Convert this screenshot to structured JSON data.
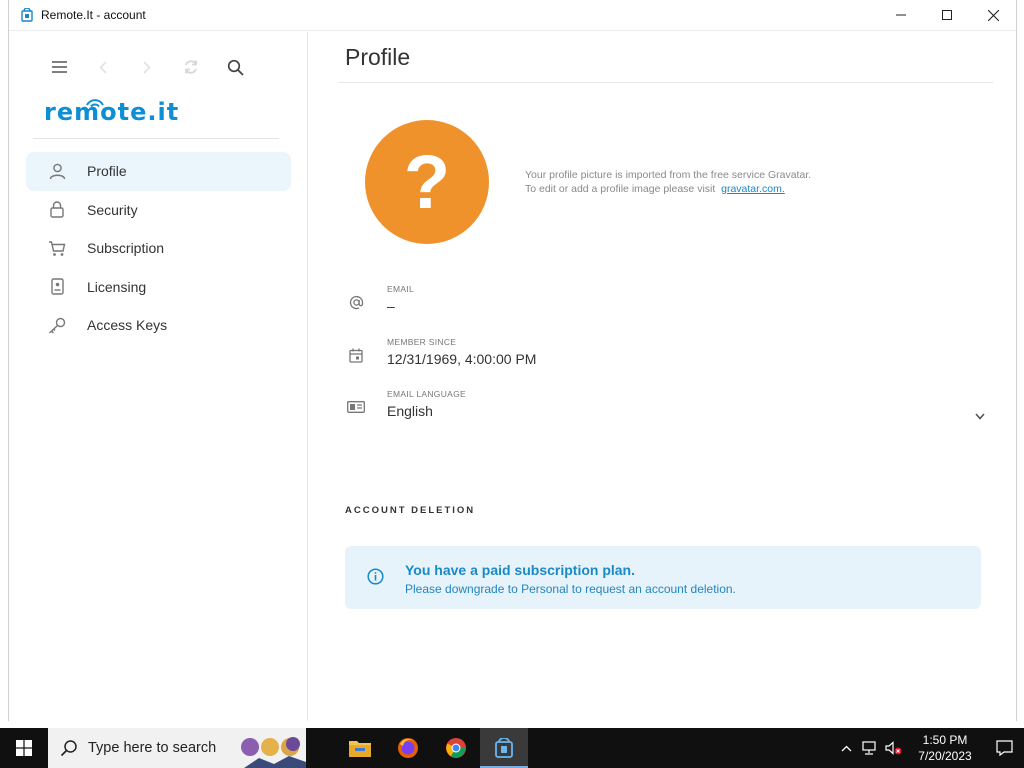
{
  "window": {
    "title": "Remote.It - account",
    "minimize_icon": "minimize-icon",
    "maximize_icon": "maximize-icon",
    "close_icon": "close-icon"
  },
  "sidebar": {
    "logo_text": "remote.it",
    "toolbar": [
      "menu-icon",
      "back-icon",
      "forward-icon",
      "refresh-icon",
      "search-icon"
    ],
    "items": [
      {
        "label": "Profile",
        "icon": "person-icon",
        "active": true
      },
      {
        "label": "Security",
        "icon": "lock-icon",
        "active": false
      },
      {
        "label": "Subscription",
        "icon": "cart-icon",
        "active": false
      },
      {
        "label": "Licensing",
        "icon": "badge-icon",
        "active": false
      },
      {
        "label": "Access Keys",
        "icon": "key-icon",
        "active": false
      }
    ]
  },
  "main": {
    "title": "Profile",
    "avatar_symbol": "?",
    "gravatar_line1": "Your profile picture is imported from the free service Gravatar.",
    "gravatar_line2": "To edit or add a profile image please visit",
    "gravatar_link": "gravatar.com.",
    "fields": {
      "email": {
        "label": "EMAIL",
        "value": "–"
      },
      "member_since": {
        "label": "MEMBER SINCE",
        "value": "12/31/1969, 4:00:00 PM"
      },
      "email_language": {
        "label": "EMAIL LANGUAGE",
        "value": "English"
      }
    },
    "account_deletion_label": "ACCOUNT DELETION",
    "alert": {
      "title": "You have a paid subscription plan.",
      "description": "Please downgrade to Personal to request an account deletion."
    }
  },
  "taskbar": {
    "search_placeholder": "Type here to search",
    "apps": [
      "file-explorer-icon",
      "firefox-icon",
      "chrome-icon",
      "remoteit-app-icon"
    ],
    "time": "1:50 PM",
    "date": "7/20/2023"
  },
  "colors": {
    "accent": "#0e8fd4",
    "avatar": "#ef922c",
    "active_nav": "#ebf5fc",
    "alert_bg": "#e7f3fb"
  }
}
